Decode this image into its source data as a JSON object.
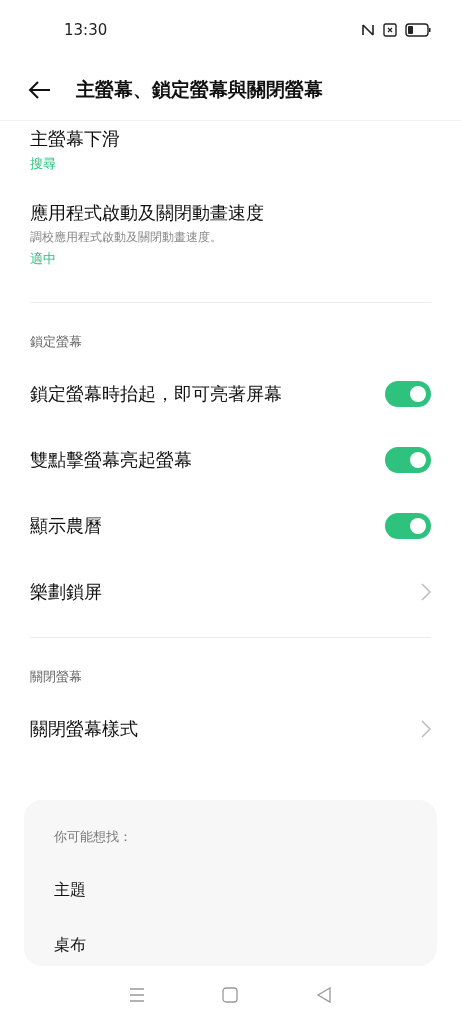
{
  "status_bar": {
    "time": "13:30"
  },
  "header": {
    "title": "主螢幕、鎖定螢幕與關閉螢幕"
  },
  "sections": [
    {
      "items": [
        {
          "kind": "value",
          "title": "主螢幕下滑",
          "value": "搜尋"
        },
        {
          "kind": "value",
          "title": "應用程式啟動及關閉動畫速度",
          "subtitle": "調校應用程式啟動及關閉動畫速度。",
          "value": "適中"
        }
      ]
    },
    {
      "label": "鎖定螢幕",
      "items": [
        {
          "kind": "toggle",
          "title": "鎖定螢幕時抬起，即可亮著屏幕",
          "on": true
        },
        {
          "kind": "toggle",
          "title": "雙點擊螢幕亮起螢幕",
          "on": true
        },
        {
          "kind": "toggle",
          "title": "顯示農曆",
          "on": true
        },
        {
          "kind": "chevron",
          "title": "樂劃鎖屏"
        }
      ]
    },
    {
      "label": "關閉螢幕",
      "items": [
        {
          "kind": "chevron",
          "title": "關閉螢幕樣式"
        }
      ]
    }
  ],
  "suggestions": {
    "label": "你可能想找：",
    "items": [
      "主題",
      "桌布"
    ]
  }
}
